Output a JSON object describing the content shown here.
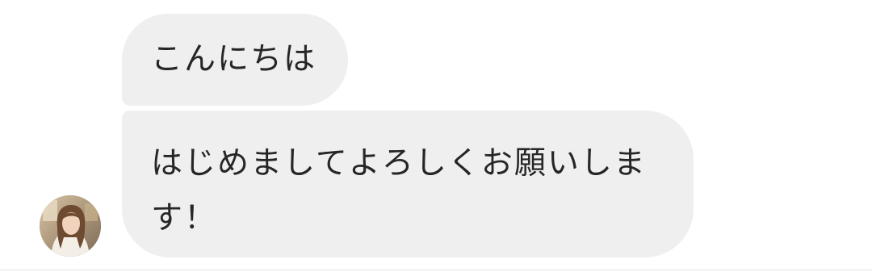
{
  "messages": [
    {
      "lines": [
        "こんにちは"
      ]
    },
    {
      "lines": [
        "はじめましてよろしくお願いしま",
        "す！"
      ]
    }
  ],
  "avatar": {
    "icon": "profile-photo-avatar"
  },
  "colors": {
    "bubble_background": "#efefef",
    "text": "#262626",
    "page_background": "#ffffff",
    "divider": "#e3e3e3"
  }
}
